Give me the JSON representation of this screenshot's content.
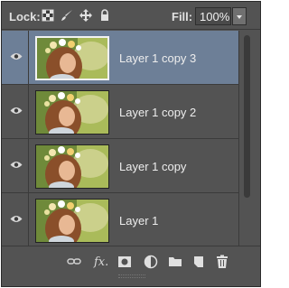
{
  "toolbar_top": {
    "lock_label": "Lock:",
    "lock_icons": [
      "lock-transparent-pixels-icon",
      "lock-image-pixels-icon",
      "lock-position-icon",
      "lock-all-icon"
    ],
    "fill_label": "Fill:",
    "fill_value": "100%"
  },
  "layers": [
    {
      "name": "Layer 1 copy 3",
      "visible": true,
      "selected": true
    },
    {
      "name": "Layer 1 copy 2",
      "visible": true,
      "selected": false
    },
    {
      "name": "Layer 1 copy",
      "visible": true,
      "selected": false
    },
    {
      "name": "Layer 1",
      "visible": true,
      "selected": false
    }
  ],
  "bottom_toolbar": {
    "icons": [
      "link-layers-icon",
      "layer-style-icon",
      "add-mask-icon",
      "adjustment-layer-icon",
      "new-group-icon",
      "new-layer-icon",
      "delete-layer-icon"
    ],
    "fx_label": "fx."
  },
  "colors": {
    "panel_bg": "#535353",
    "selected_bg": "#6d7f97",
    "text": "#ededed"
  }
}
